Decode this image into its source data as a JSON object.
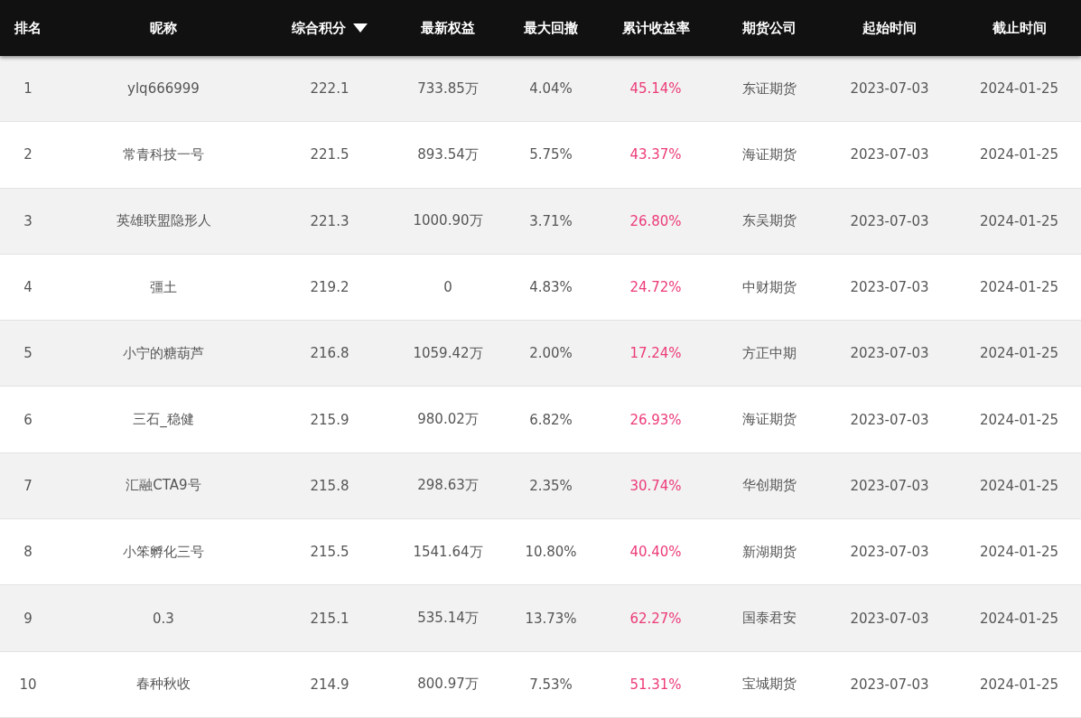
{
  "table": {
    "columns": [
      {
        "label": "排名",
        "sorted": false
      },
      {
        "label": "昵称",
        "sorted": false
      },
      {
        "label": "综合积分",
        "sorted": true
      },
      {
        "label": "最新权益",
        "sorted": false
      },
      {
        "label": "最大回撤",
        "sorted": false
      },
      {
        "label": "累计收益率",
        "sorted": false
      },
      {
        "label": "期货公司",
        "sorted": false
      },
      {
        "label": "起始时间",
        "sorted": false
      },
      {
        "label": "截止时间",
        "sorted": false
      }
    ],
    "rows": [
      [
        "1",
        "ylq666999",
        "222.1",
        "733.85万",
        "4.04%",
        "45.14%",
        "东证期货",
        "2023-07-03",
        "2024-01-25"
      ],
      [
        "2",
        "常青科技一号",
        "221.5",
        "893.54万",
        "5.75%",
        "43.37%",
        "海证期货",
        "2023-07-03",
        "2024-01-25"
      ],
      [
        "3",
        "英雄联盟隐形人",
        "221.3",
        "1000.90万",
        "3.71%",
        "26.80%",
        "东吴期货",
        "2023-07-03",
        "2024-01-25"
      ],
      [
        "4",
        "彊土",
        "219.2",
        "0",
        "4.83%",
        "24.72%",
        "中财期货",
        "2023-07-03",
        "2024-01-25"
      ],
      [
        "5",
        "小宁的糖葫芦",
        "216.8",
        "1059.42万",
        "2.00%",
        "17.24%",
        "方正中期",
        "2023-07-03",
        "2024-01-25"
      ],
      [
        "6",
        "三石_稳健",
        "215.9",
        "980.02万",
        "6.82%",
        "26.93%",
        "海证期货",
        "2023-07-03",
        "2024-01-25"
      ],
      [
        "7",
        "汇融CTA9号",
        "215.8",
        "298.63万",
        "2.35%",
        "30.74%",
        "华创期货",
        "2023-07-03",
        "2024-01-25"
      ],
      [
        "8",
        "小笨孵化三号",
        "215.5",
        "1541.64万",
        "10.80%",
        "40.40%",
        "新湖期货",
        "2023-07-03",
        "2024-01-25"
      ],
      [
        "9",
        "0.3",
        "215.1",
        "535.14万",
        "13.73%",
        "62.27%",
        "国泰君安",
        "2023-07-03",
        "2024-01-25"
      ],
      [
        "10",
        "春种秋收",
        "214.9",
        "800.97万",
        "7.53%",
        "51.31%",
        "宝城期货",
        "2023-07-03",
        "2024-01-25"
      ]
    ]
  }
}
